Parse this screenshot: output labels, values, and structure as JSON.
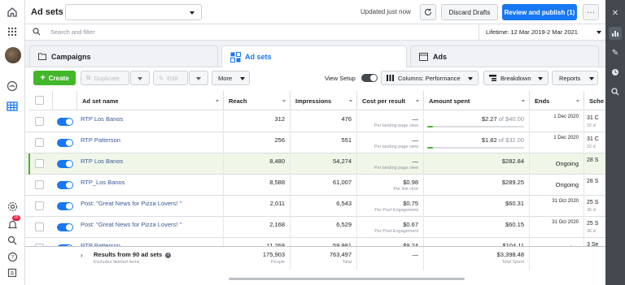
{
  "header": {
    "title": "Ad sets",
    "updated_text": "Updated just now",
    "discard_label": "Discard Drafts",
    "publish_label": "Review and publish (1)",
    "more_label": "···"
  },
  "search": {
    "placeholder": "Search and filter",
    "lifetime": "Lifetime: 12 Mar 2019-2 Mar 2021"
  },
  "tabs": [
    {
      "label": "Campaigns"
    },
    {
      "label": "Ad sets"
    },
    {
      "label": "Ads"
    }
  ],
  "toolbar": {
    "create": "Create",
    "duplicate": "Duplicate",
    "edit": "Edit",
    "more": "More",
    "view_setup": "View Setup",
    "columns": "Columns: Performance",
    "breakdown": "Breakdown",
    "reports": "Reports"
  },
  "columns": [
    "Ad set name",
    "Reach",
    "Impressions",
    "Cost per result",
    "Amount spent",
    "Ends",
    "Sche"
  ],
  "rows": [
    {
      "name": "RTP Los Banos",
      "reach": "312",
      "impressions": "476",
      "cpr": "—",
      "cpr_sub": "Per landing page view",
      "spent": "$2.27",
      "spent_of": " of $40.00",
      "budget_fraction": 0.06,
      "ends": "1 Dec 2020",
      "ends_sub": "",
      "sched": "31 C",
      "sched_sub": "32 d",
      "highlight": false
    },
    {
      "name": "RTP Patterson",
      "reach": "256",
      "impressions": "551",
      "cpr": "—",
      "cpr_sub": "Per landing page view",
      "spent": "$1.82",
      "spent_of": " of $32.00",
      "budget_fraction": 0.06,
      "ends": "1 Dec 2020",
      "ends_sub": "",
      "sched": "31 C",
      "sched_sub": "32 d",
      "highlight": false
    },
    {
      "name": "RTP Los Banos",
      "reach": "8,480",
      "impressions": "54,274",
      "cpr": "—",
      "cpr_sub": "Per landing page view",
      "spent": "$282.84",
      "spent_of": "",
      "ends": "Ongoing",
      "ends_sub": "",
      "sched": "28 S",
      "sched_sub": "",
      "highlight": true
    },
    {
      "name": "RTP_Los Banos",
      "reach": "8,588",
      "impressions": "61,007",
      "cpr": "$0.98",
      "cpr_sub": "Per link click",
      "spent": "$289.25",
      "spent_of": "",
      "ends": "Ongoing",
      "ends_sub": "",
      "sched": "28 S",
      "sched_sub": "",
      "highlight": false
    },
    {
      "name": "Post: \"Great News for Pizza Lovers! \"",
      "reach": "2,011",
      "impressions": "6,543",
      "cpr": "$0.75",
      "cpr_sub": "Per Post Engagement",
      "spent": "$60.31",
      "spent_of": "",
      "ends": "31 Oct 2020",
      "ends_sub": "",
      "sched": "25 S",
      "sched_sub": "36 d",
      "highlight": false
    },
    {
      "name": "Post: \"Great News for Pizza Lovers! \"",
      "reach": "2,168",
      "impressions": "6,529",
      "cpr": "$0.67",
      "cpr_sub": "Per Post Engagement",
      "spent": "$60.15",
      "spent_of": "",
      "ends": "31 Oct 2020",
      "ends_sub": "",
      "sched": "25 S",
      "sched_sub": "36 d",
      "highlight": false
    },
    {
      "name": "RTP Patterson",
      "reach": "11,268",
      "impressions": "59,981",
      "cpr": "$9.24",
      "cpr_sub": "",
      "spent": "$104.11",
      "spent_of": "",
      "ends": "Ongoing",
      "ends_sub": "",
      "sched": "3 Se",
      "sched_sub": "",
      "highlight": false
    }
  ],
  "summary": {
    "label": "Results from 90 ad sets",
    "sub": "Excludes deleted items",
    "reach": "175,903",
    "reach_sub": "People",
    "impressions": "763,497",
    "impressions_sub": "Total",
    "cpr": "—",
    "spent": "$3,398.48",
    "spent_sub": "Total Spent"
  },
  "left_nav": {
    "notification_count": "15"
  },
  "colors": {
    "accent": "#1877f2",
    "create": "#42b72a",
    "rail": "#444950"
  }
}
